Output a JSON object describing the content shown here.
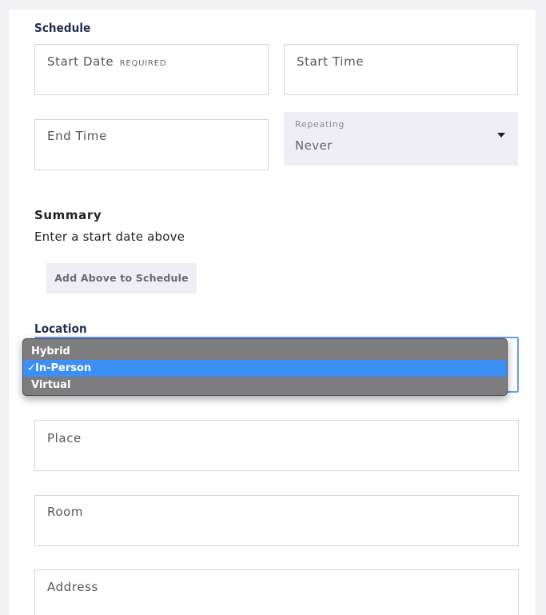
{
  "schedule": {
    "heading": "Schedule",
    "start_date": {
      "label": "Start Date",
      "required": "REQUIRED"
    },
    "start_time": {
      "label": "Start Time"
    },
    "end_time": {
      "label": "End Time"
    },
    "repeating": {
      "label": "Repeating",
      "value": "Never"
    }
  },
  "summary": {
    "title": "Summary",
    "text": "Enter a start date above",
    "button": "Add Above to Schedule"
  },
  "location": {
    "heading": "Location",
    "options": [
      {
        "label": "Hybrid",
        "selected": false
      },
      {
        "label": "In-Person",
        "selected": true
      },
      {
        "label": "Virtual",
        "selected": false
      }
    ],
    "check": "✓",
    "place": {
      "label": "Place"
    },
    "room": {
      "label": "Room"
    },
    "address": {
      "label": "Address"
    }
  },
  "colors": {
    "heading": "#1f2d4d",
    "dropdown_bg": "#7d7d80",
    "selected_option": "#3b8ff5",
    "focus_border": "#6f9bf0"
  }
}
